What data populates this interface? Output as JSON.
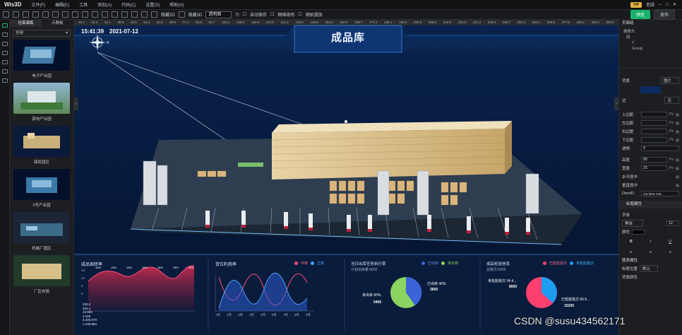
{
  "app": {
    "name": "Wis3D"
  },
  "menu": [
    "文件(F)",
    "编辑(E)",
    "工具",
    "添加(A)",
    "代码(C)",
    "设置(S)",
    "帮助(H)"
  ],
  "topright": {
    "vip": "VIP",
    "user": "老師"
  },
  "toolbar": {
    "hide2d": "隐藏2D",
    "hide3d": "隐藏3D",
    "mode": "透明图",
    "autosave": "自动保存",
    "grid": "网格吸附",
    "random": "随机摆放",
    "preview": "预览",
    "publish": "发布"
  },
  "left": {
    "tabs": [
      "仿真演练",
      "示教板"
    ],
    "filter": "全部",
    "items": [
      "电子产业园",
      "家电产业园",
      "康民园区",
      "5号产业园",
      "机械厂园区",
      "厂区布局"
    ]
  },
  "scene": {
    "time": "15:41:39",
    "date": "2021-07-12",
    "title": "成品库",
    "compass": "N"
  },
  "ruler": [
    "15.7",
    "23.4",
    "31.1",
    "38.8",
    "46.5",
    "54.2",
    "61.9",
    "69.6",
    "77.3",
    "85.0",
    "92.7",
    "100.4",
    "108.1",
    "115.8",
    "123.5",
    "131.2",
    "138.9",
    "146.6",
    "154.3",
    "162.0",
    "169.7",
    "177.4",
    "185.1",
    "192.8",
    "200.5",
    "208.2",
    "215.9",
    "223.6",
    "231.3",
    "239.0",
    "246.7",
    "254.4",
    "262.1",
    "269.8",
    "277.5",
    "285.2",
    "292.9",
    "300.6"
  ],
  "panels": {
    "p1": {
      "title": "成品周转率",
      "stats": [
        "200.4",
        "102.1",
        "23.608",
        "4.443",
        "3.326.070",
        "1.108.684"
      ],
      "labels": [
        "15%",
        "15%",
        "15%",
        "15%",
        "15%",
        "15%",
        "15%"
      ],
      "ticks": [
        "15",
        "12",
        "9",
        "6",
        "3",
        "0"
      ]
    },
    "p2": {
      "title": "货位利用率",
      "legend": [
        "平库",
        "立库"
      ],
      "x": [
        "1月",
        "2月",
        "3月",
        "4月",
        "5月",
        "6月",
        "7月",
        "8月",
        "9月"
      ]
    },
    "p3": {
      "title": "当日出库任务执行率",
      "sub": "计划出库量:9000",
      "legend": [
        "已出库",
        "未出库"
      ],
      "out_label": "已出库 40%",
      "out_val": "3600",
      "not_label": "未出库 60%",
      "not_val": "5400"
    },
    "p4": {
      "title": "成品检验信息",
      "sub": "总数次:5000",
      "legend": [
        "已检验批次",
        "未检验批次"
      ],
      "a_label": "未检验批次 34.4...",
      "a_val": "8000",
      "b_label": "已检验批次 65.5...",
      "b_val": "15200"
    }
  },
  "right": {
    "title": "页面组",
    "tree": [
      "摄像头",
      "组",
      "T",
      "Group"
    ],
    "bg_label": "背景",
    "bg_val": "图片",
    "border_label": "边",
    "border_val": "无",
    "fields": [
      "上边距",
      "左边距",
      "右边距",
      "下边距",
      "透明",
      "高度",
      "宽度",
      "水平居中",
      "垂直居中",
      "DomID"
    ],
    "opacity": "0",
    "height": "80",
    "width": "25",
    "domid": "domb06-158...",
    "font_section": "标题属性",
    "font_label": "字体",
    "font_val": "黑体",
    "size_val": "12",
    "color_label": "颜色",
    "caption": "图表属性",
    "pos_label": "标题位置",
    "pos_val": "默认",
    "bg2": "背景颜色"
  },
  "watermark": "CSDN @susu434562171"
}
